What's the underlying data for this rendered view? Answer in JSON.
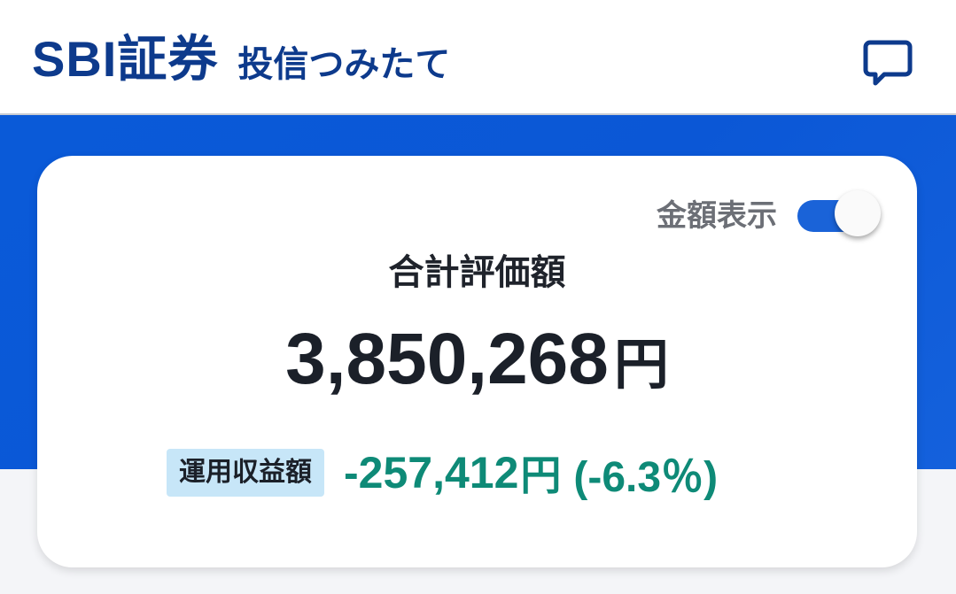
{
  "header": {
    "brand_logo": "SBI証券",
    "service_name": "投信つみたて",
    "chat_icon": "chat-bubble-icon",
    "brand_color": "#0d3a8c"
  },
  "summary": {
    "toggle_label": "金額表示",
    "toggle_on": true,
    "total_label": "合計評価額",
    "total_value": "3,850,268",
    "total_unit": "円",
    "profit_badge": "運用収益額",
    "profit_value": "-257,412",
    "profit_unit": "円",
    "profit_rate": "(-6.3％)",
    "accent_color": "#0b57d6",
    "profit_color": "#0e8a77"
  }
}
